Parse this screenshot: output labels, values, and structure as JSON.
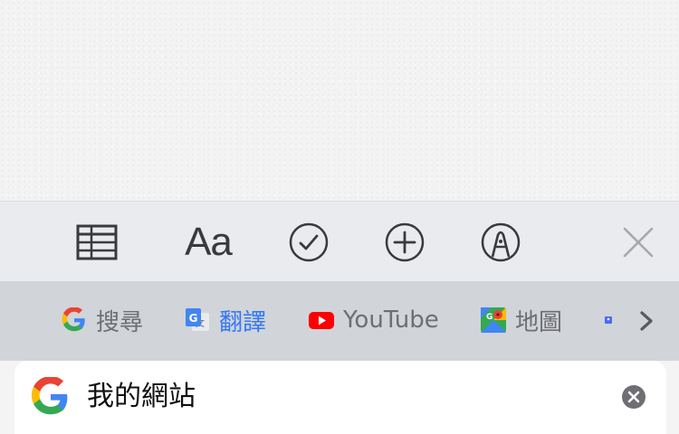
{
  "toolbar": {
    "items": [
      {
        "name": "table",
        "icon": "table-icon"
      },
      {
        "name": "format",
        "label": "Aa"
      },
      {
        "name": "checklist",
        "icon": "checkmark-circle-icon"
      },
      {
        "name": "add",
        "icon": "plus-circle-icon"
      },
      {
        "name": "markup",
        "icon": "pen-tip-circle-icon"
      },
      {
        "name": "close",
        "icon": "close-icon"
      }
    ],
    "icon_color": "#3a3a3c",
    "close_color": "#a7a8ab"
  },
  "shortcuts": {
    "items": [
      {
        "label": "搜尋",
        "icon": "google-g-icon",
        "active": false
      },
      {
        "label": "翻譯",
        "icon": "google-translate-icon",
        "active": true
      },
      {
        "label": "YouTube",
        "icon": "youtube-icon",
        "active": false
      },
      {
        "label": "地圖",
        "icon": "google-maps-icon",
        "active": false
      }
    ],
    "more_icon": "chevron-right-icon",
    "active_color": "#3478f6",
    "text_color": "#6e6e73"
  },
  "search": {
    "value": "我的網站",
    "logo": "google-g-icon",
    "clear_icon": "clear-circle-icon"
  }
}
